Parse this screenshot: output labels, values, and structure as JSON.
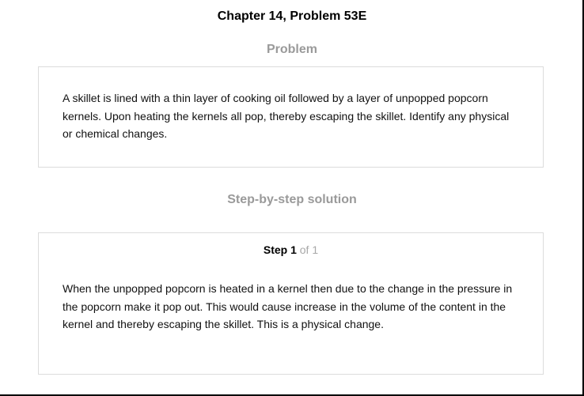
{
  "page": {
    "title": "Chapter 14, Problem 53E"
  },
  "problem": {
    "heading": "Problem",
    "text": "A skillet is lined with a thin layer of cooking oil followed by a layer of unpopped popcorn kernels. Upon heating the kernels all pop, thereby escaping the skillet. Identify any physical or chemical changes."
  },
  "solution": {
    "heading": "Step-by-step solution",
    "step_label": "Step 1",
    "step_of": "of 1",
    "text": "When the unpopped popcorn is heated in a kernel then due to the change in the pressure in the popcorn make it pop out. This would cause increase in the volume of the content in the kernel and thereby escaping the skillet. This is a physical change."
  },
  "colors": {
    "heading_gray": "#9a9a9a",
    "card_border": "#dcdcdc",
    "step_of_gray": "#a8a8a8"
  }
}
